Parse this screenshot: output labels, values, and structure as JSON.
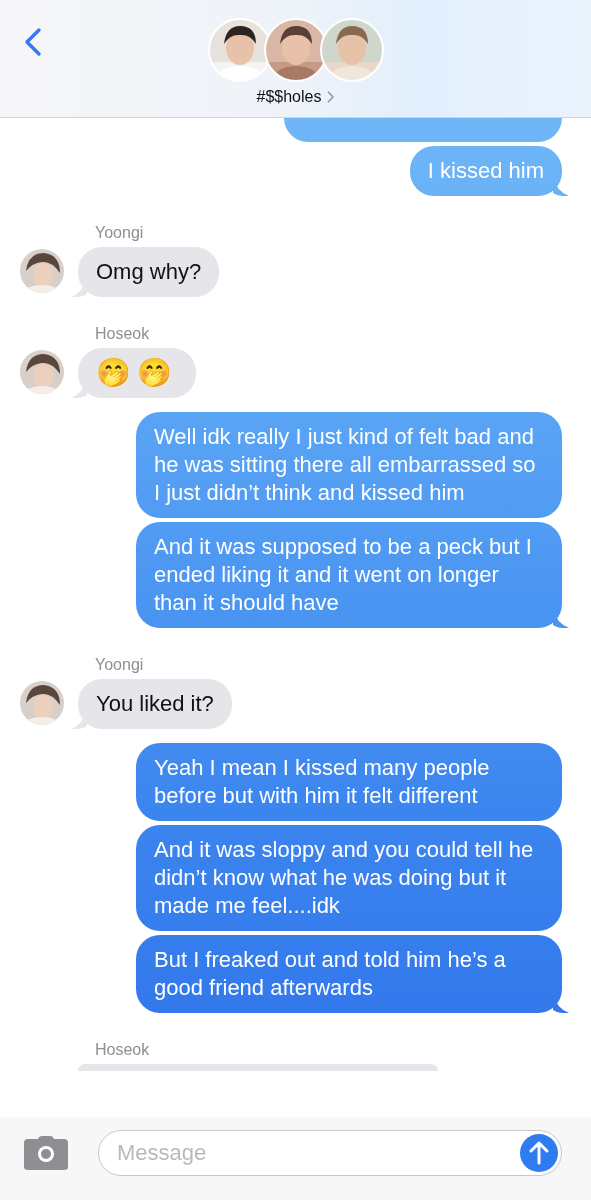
{
  "header": {
    "title": "#$$holes",
    "avatars": [
      {
        "kind": "picture"
      },
      {
        "kind": "picture"
      },
      {
        "kind": "picture"
      }
    ]
  },
  "groups": [
    {
      "kind": "outgoing",
      "messages": [
        {
          "kind": "covered"
        },
        {
          "kind": "text",
          "text": "I kissed him"
        }
      ]
    },
    {
      "kind": "incoming",
      "sender": "Yoongi",
      "avatar": {
        "kind": "picture"
      },
      "messages": [
        {
          "kind": "text",
          "text": "Omg why?"
        }
      ]
    },
    {
      "kind": "incoming",
      "sender": "Hoseok",
      "avatar": {
        "kind": "picture"
      },
      "messages": [
        {
          "kind": "emoji",
          "text": "🤭🤭"
        }
      ]
    },
    {
      "kind": "outgoing",
      "messages": [
        {
          "kind": "text",
          "text": "Well idk really I just kind of felt bad and he was sitting there all embarrassed so I just didn’t think and kissed him"
        },
        {
          "kind": "text",
          "text": "And it was supposed to be a peck but I ended liking it and it went on longer than it should have"
        }
      ]
    },
    {
      "kind": "incoming",
      "sender": "Yoongi",
      "avatar": {
        "kind": "picture"
      },
      "messages": [
        {
          "kind": "text",
          "text": "You liked it?"
        }
      ]
    },
    {
      "kind": "outgoing",
      "messages": [
        {
          "kind": "text",
          "text": "Yeah I mean I kissed many people before but with him it felt different"
        },
        {
          "kind": "text",
          "text": "And it was sloppy and you could tell he didn’t know what he was doing but it made me feel....idk"
        },
        {
          "kind": "text",
          "text": "But I freaked out and told him he’s a good friend afterwards"
        }
      ]
    },
    {
      "kind": "incoming",
      "sender": "Hoseok",
      "messages": [
        {
          "kind": "covered"
        }
      ]
    }
  ],
  "composer": {
    "placeholder": "Message"
  }
}
